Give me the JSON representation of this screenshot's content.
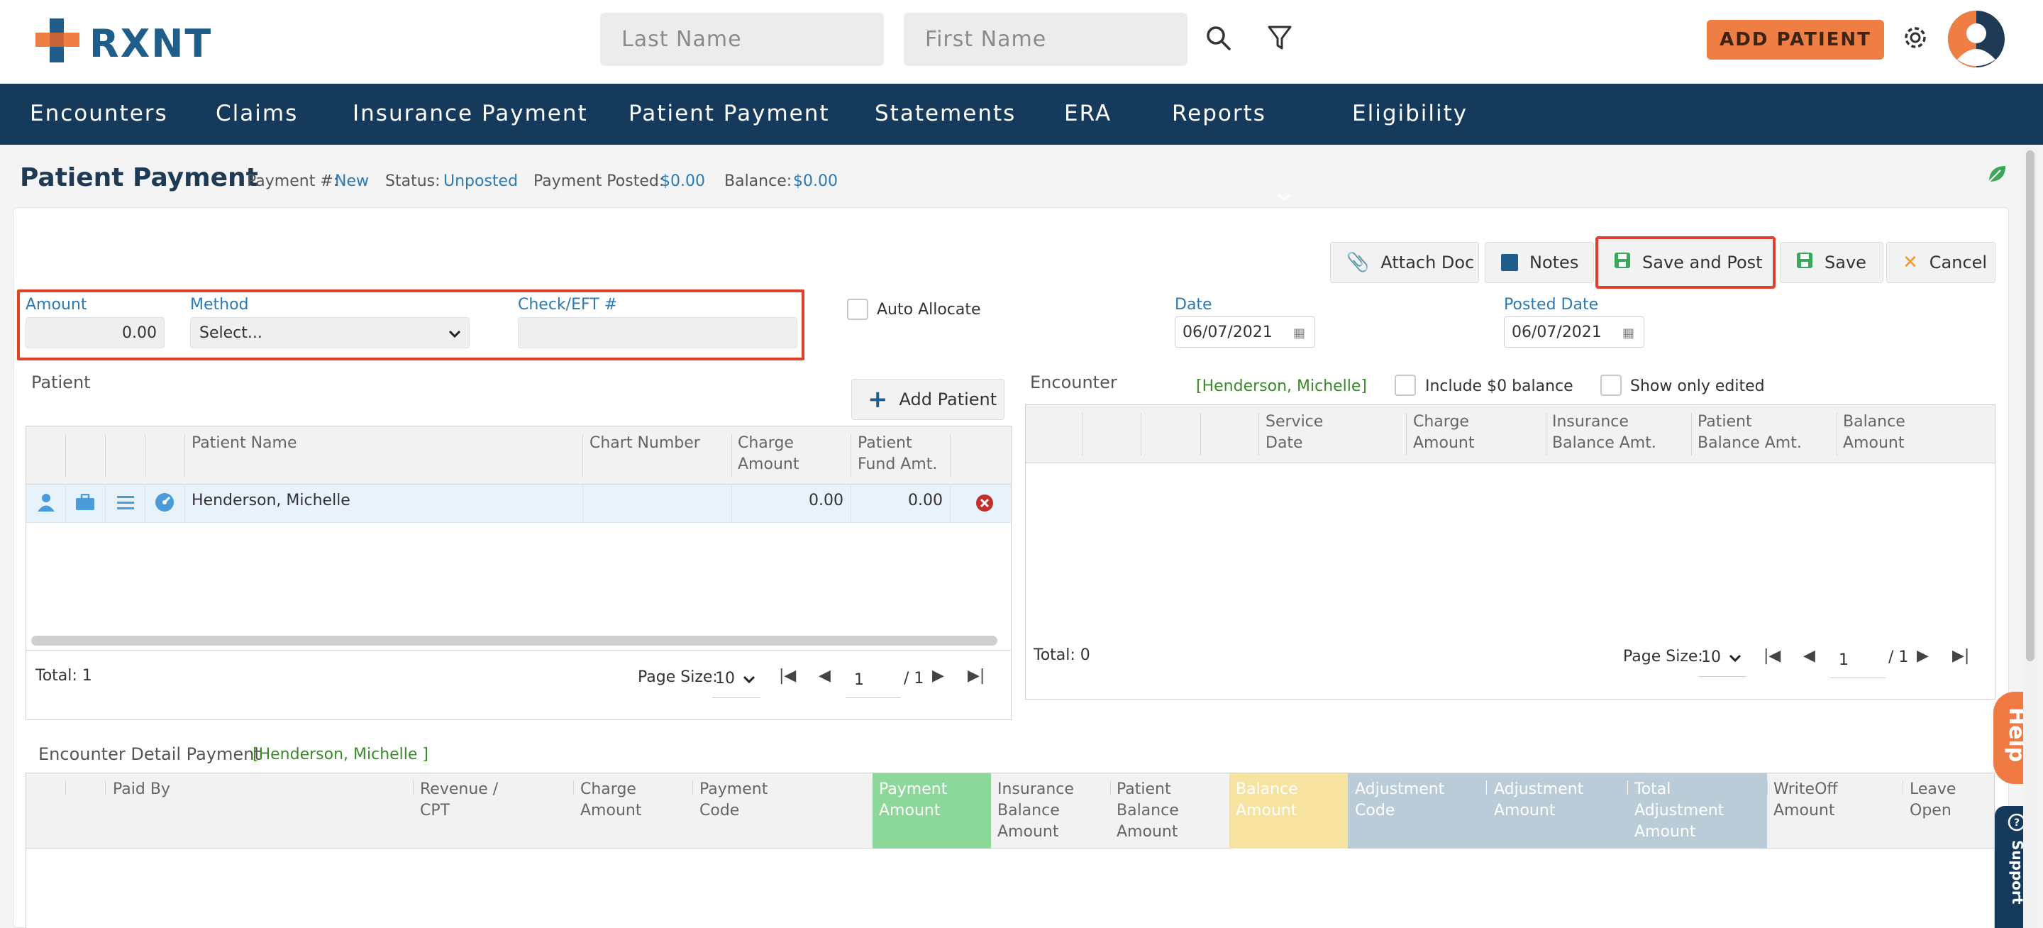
{
  "header": {
    "logo_text": "RXNT",
    "last_name_placeholder": "Last Name",
    "first_name_placeholder": "First Name",
    "add_patient_label": "ADD PATIENT"
  },
  "nav": {
    "items": [
      "Encounters",
      "Claims",
      "Insurance Payment",
      "Patient Payment",
      "Statements",
      "ERA",
      "Reports",
      "Eligibility"
    ]
  },
  "titlebar": {
    "title": "Patient Payment",
    "payment_no_label": "Payment #:",
    "payment_no_value": "New",
    "status_label": "Status:",
    "status_value": "Unposted",
    "posted_label": "Payment Posted:",
    "posted_value": "$0.00",
    "balance_label": "Balance:",
    "balance_value": "$0.00"
  },
  "toolbar": {
    "attach_doc": "Attach Doc",
    "notes": "Notes",
    "save_and_post": "Save and Post",
    "save": "Save",
    "cancel": "Cancel"
  },
  "form": {
    "amount_label": "Amount",
    "amount_value": "0.00",
    "method_label": "Method",
    "method_value": "Select...",
    "check_label": "Check/EFT #",
    "check_value": "",
    "auto_allocate": "Auto Allocate",
    "date_label": "Date",
    "date_value": "06/07/2021",
    "posted_date_label": "Posted Date",
    "posted_date_value": "06/07/2021"
  },
  "patient_grid": {
    "section_label": "Patient",
    "add_patient": "Add Patient",
    "headers": {
      "name": "Patient Name",
      "chart": "Chart Number",
      "charge_1": "Charge",
      "charge_2": "Amount",
      "fund_1": "Patient",
      "fund_2": "Fund Amt."
    },
    "row": {
      "name": "Henderson, Michelle",
      "chart": "",
      "charge": "0.00",
      "fund": "0.00"
    },
    "total": "Total: 1",
    "page_size_label": "Page Size:",
    "page_size": "10",
    "page": "1",
    "page_of": "/ 1"
  },
  "encounter_grid": {
    "section_label": "Encounter",
    "patient_tag": "[Henderson, Michelle]",
    "include_zero": "Include $0 balance",
    "only_edited": "Show only edited",
    "headers": {
      "service_1": "Service",
      "service_2": "Date",
      "charge_1": "Charge",
      "charge_2": "Amount",
      "ins_1": "Insurance",
      "ins_2": "Balance Amt.",
      "pat_1": "Patient",
      "pat_2": "Balance Amt.",
      "bal_1": "Balance",
      "bal_2": "Amount"
    },
    "total": "Total: 0",
    "page_size_label": "Page Size:",
    "page_size": "10",
    "page": "1",
    "page_of": "/ 1"
  },
  "detail_grid": {
    "section_label": "Encounter Detail Payment",
    "patient_tag": "[Henderson, Michelle   ]",
    "headers": {
      "paid_by": "Paid By",
      "rev_1": "Revenue /",
      "rev_2": "CPT",
      "charge_1": "Charge",
      "charge_2": "Amount",
      "pcode_1": "Payment",
      "pcode_2": "Code",
      "pamt_1": "Payment",
      "pamt_2": "Amount",
      "ins_1": "Insurance",
      "ins_2": "Balance",
      "ins_3": "Amount",
      "pat_1": "Patient",
      "pat_2": "Balance",
      "pat_3": "Amount",
      "bal_1": "Balance",
      "bal_2": "Amount",
      "adjc_1": "Adjustment",
      "adjc_2": "Code",
      "adja_1": "Adjustment",
      "adja_2": "Amount",
      "tadj_1": "Total",
      "tadj_2": "Adjustment",
      "tadj_3": "Amount",
      "wo_1": "WriteOff",
      "wo_2": "Amount",
      "lo_1": "Leave",
      "lo_2": "Open"
    }
  },
  "side": {
    "help": "Help",
    "support": "Support"
  },
  "colors": {
    "nav_bg": "#163a5c",
    "accent_orange": "#ef7e45",
    "link_blue": "#2a7ab8",
    "highlight_red": "#e1402a",
    "payment_amount_green": "#8bd89a",
    "balance_amount_yellow": "#f7e3a0",
    "adjustment_blue": "#b9ccd8"
  }
}
